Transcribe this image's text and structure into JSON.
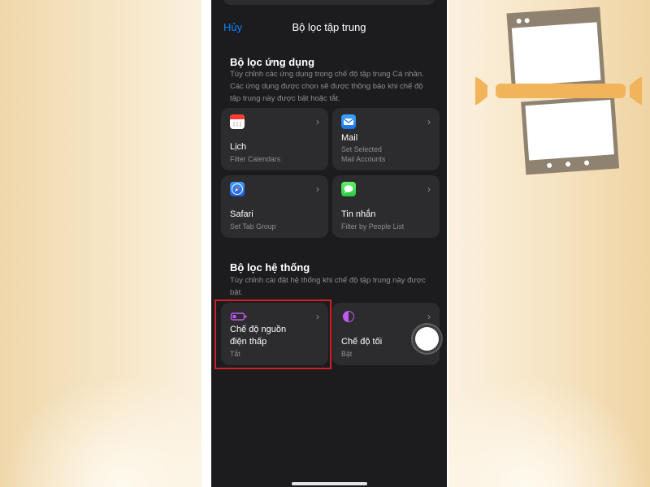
{
  "nav": {
    "cancel_label": "Hủy",
    "title": "Bộ lọc tập trung"
  },
  "app_filters": {
    "title": "Bộ lọc ứng dụng",
    "description": "Tùy chỉnh các ứng dụng trong chế độ tập trung Cá nhân. Các ứng dụng được chọn sẽ được thông báo khi chế độ tập trung này được bật hoặc tắt.",
    "items": [
      {
        "name": "Lịch",
        "sub": "Filter Calendars",
        "icon": "calendar-icon"
      },
      {
        "name": "Mail",
        "sub": "Set Selected\nMail Accounts",
        "icon": "mail-icon"
      },
      {
        "name": "Safari",
        "sub": "Set Tab Group",
        "icon": "safari-icon"
      },
      {
        "name": "Tin nhắn",
        "sub": "Filter by People List",
        "icon": "messages-icon"
      }
    ]
  },
  "system_filters": {
    "title": "Bộ lọc hệ thống",
    "description": "Tùy chỉnh cài đặt hệ thống khi chế độ tập trung này được bật.",
    "items": [
      {
        "name": "Chế độ nguồn\nđiện thấp",
        "sub": "Tắt",
        "icon": "low-power-battery-icon"
      },
      {
        "name": "Chế độ tối",
        "sub": "Bật",
        "icon": "dark-mode-icon"
      }
    ]
  },
  "colors": {
    "accent": "#0a84ff",
    "background": "#1c1c1e",
    "card": "#2c2c2e",
    "secondary_text": "#8e8e93",
    "highlight_border": "#d0202a",
    "battery_purple": "#bf5af2"
  }
}
